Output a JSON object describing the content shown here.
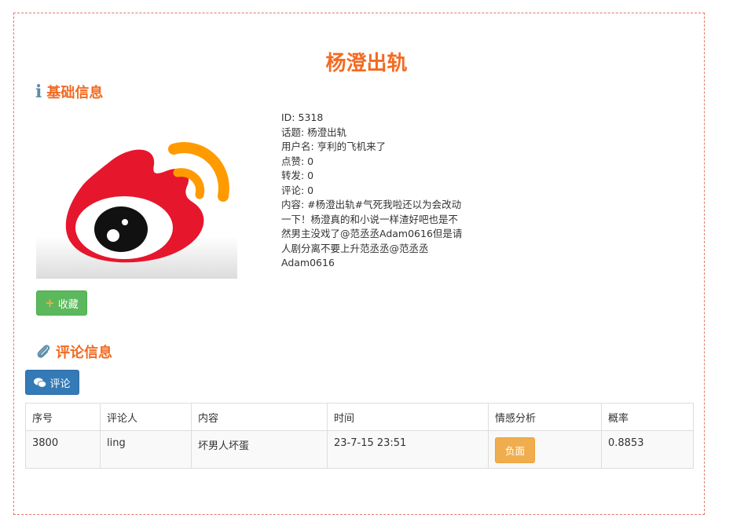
{
  "page": {
    "title": "杨澄出轨"
  },
  "basic_info": {
    "heading": "基础信息",
    "icon": "info-icon",
    "id_line": "ID: 5318",
    "topic_line": "话题: 杨澄出轨",
    "user_line": "用户名: 亨利的飞机来了",
    "likes_line": "点赞: 0",
    "reposts_line": "转发: 0",
    "comments_line": "评论: 0",
    "content_line": "内容: #杨澄出轨#气死我啦还以为会改动一下！杨澄真的和小说一样渣好吧也是不然男主没戏了@范丞丞Adam0616但是请人剧分离不要上升范丞丞@范丞丞Adam0616",
    "favorite_label": "收藏"
  },
  "comment_info": {
    "heading": "评论信息",
    "icon": "paperclip-icon",
    "comment_button_label": "评论",
    "columns": [
      "序号",
      "评论人",
      "内容",
      "时间",
      "情感分析",
      "概率"
    ],
    "rows": [
      {
        "no": "3800",
        "user": "ling",
        "content": "坏男人坏蛋",
        "time": "23-7-15 23:51",
        "sentiment": "负面",
        "prob": "0.8853"
      }
    ]
  },
  "colors": {
    "accent": "#f26b22",
    "success": "#5cb85c",
    "primary": "#337ab7",
    "warning": "#f0ad4e"
  }
}
